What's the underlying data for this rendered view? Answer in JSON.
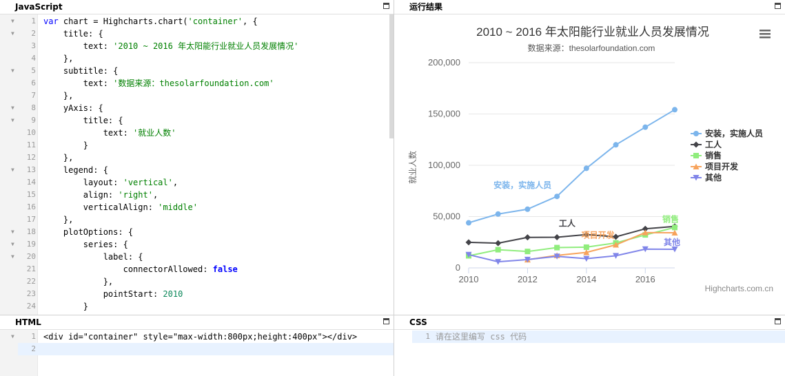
{
  "panels": {
    "js": {
      "title": "JavaScript"
    },
    "result": {
      "title": "运行结果"
    },
    "html": {
      "title": "HTML"
    },
    "css": {
      "title": "CSS"
    }
  },
  "js_lines": [
    {
      "n": "1",
      "fold": true,
      "tokens": [
        {
          "t": "var ",
          "c": "kw"
        },
        {
          "t": "chart = Highcharts.chart(",
          "c": ""
        },
        {
          "t": "'container'",
          "c": "str"
        },
        {
          "t": ", {",
          "c": ""
        }
      ]
    },
    {
      "n": "2",
      "fold": true,
      "tokens": [
        {
          "t": "    title: {",
          "c": ""
        }
      ]
    },
    {
      "n": "3",
      "fold": false,
      "tokens": [
        {
          "t": "        text: ",
          "c": ""
        },
        {
          "t": "'2010 ~ 2016 年太阳能行业就业人员发展情况'",
          "c": "str"
        }
      ]
    },
    {
      "n": "4",
      "fold": false,
      "tokens": [
        {
          "t": "    },",
          "c": ""
        }
      ]
    },
    {
      "n": "5",
      "fold": true,
      "tokens": [
        {
          "t": "    subtitle: {",
          "c": ""
        }
      ]
    },
    {
      "n": "6",
      "fold": false,
      "tokens": [
        {
          "t": "        text: ",
          "c": ""
        },
        {
          "t": "'数据来源：thesolarfoundation.com'",
          "c": "str"
        }
      ]
    },
    {
      "n": "7",
      "fold": false,
      "tokens": [
        {
          "t": "    },",
          "c": ""
        }
      ]
    },
    {
      "n": "8",
      "fold": true,
      "tokens": [
        {
          "t": "    yAxis: {",
          "c": ""
        }
      ]
    },
    {
      "n": "9",
      "fold": true,
      "tokens": [
        {
          "t": "        title: {",
          "c": ""
        }
      ]
    },
    {
      "n": "10",
      "fold": false,
      "tokens": [
        {
          "t": "            text: ",
          "c": ""
        },
        {
          "t": "'就业人数'",
          "c": "str"
        }
      ]
    },
    {
      "n": "11",
      "fold": false,
      "tokens": [
        {
          "t": "        }",
          "c": ""
        }
      ]
    },
    {
      "n": "12",
      "fold": false,
      "tokens": [
        {
          "t": "    },",
          "c": ""
        }
      ]
    },
    {
      "n": "13",
      "fold": true,
      "tokens": [
        {
          "t": "    legend: {",
          "c": ""
        }
      ]
    },
    {
      "n": "14",
      "fold": false,
      "tokens": [
        {
          "t": "        layout: ",
          "c": ""
        },
        {
          "t": "'vertical'",
          "c": "str"
        },
        {
          "t": ",",
          "c": ""
        }
      ]
    },
    {
      "n": "15",
      "fold": false,
      "tokens": [
        {
          "t": "        align: ",
          "c": ""
        },
        {
          "t": "'right'",
          "c": "str"
        },
        {
          "t": ",",
          "c": ""
        }
      ]
    },
    {
      "n": "16",
      "fold": false,
      "tokens": [
        {
          "t": "        verticalAlign: ",
          "c": ""
        },
        {
          "t": "'middle'",
          "c": "str"
        }
      ]
    },
    {
      "n": "17",
      "fold": false,
      "tokens": [
        {
          "t": "    },",
          "c": ""
        }
      ]
    },
    {
      "n": "18",
      "fold": true,
      "tokens": [
        {
          "t": "    plotOptions: {",
          "c": ""
        }
      ]
    },
    {
      "n": "19",
      "fold": true,
      "tokens": [
        {
          "t": "        series: {",
          "c": ""
        }
      ]
    },
    {
      "n": "20",
      "fold": true,
      "tokens": [
        {
          "t": "            label: {",
          "c": ""
        }
      ]
    },
    {
      "n": "21",
      "fold": false,
      "tokens": [
        {
          "t": "                connectorAllowed: ",
          "c": ""
        },
        {
          "t": "false",
          "c": "bool"
        }
      ]
    },
    {
      "n": "22",
      "fold": false,
      "tokens": [
        {
          "t": "            },",
          "c": ""
        }
      ]
    },
    {
      "n": "23",
      "fold": false,
      "tokens": [
        {
          "t": "            pointStart: ",
          "c": ""
        },
        {
          "t": "2010",
          "c": "num"
        }
      ]
    },
    {
      "n": "24",
      "fold": false,
      "tokens": [
        {
          "t": "        }",
          "c": ""
        }
      ]
    }
  ],
  "html_lines": [
    {
      "n": "1",
      "fold": true,
      "tokens": [
        {
          "t": "<div id=\"container\" style=\"max-width:800px;height:400px\"></div>",
          "c": ""
        }
      ]
    },
    {
      "n": "2",
      "fold": false,
      "tokens": []
    }
  ],
  "css_lines": [
    {
      "n": "1",
      "fold": false,
      "tokens": [
        {
          "t": "请在这里编写 css 代码",
          "c": "placeholder"
        }
      ]
    }
  ],
  "credits": "Highcharts.com.cn",
  "chart_data": {
    "type": "line",
    "title": "2010 ~ 2016 年太阳能行业就业人员发展情况",
    "subtitle": "数据来源：thesolarfoundation.com",
    "ylabel": "就业人数",
    "x": [
      2010,
      2011,
      2012,
      2013,
      2014,
      2015,
      2016,
      2017
    ],
    "xticks": [
      "2010",
      "2012",
      "2014",
      "2016"
    ],
    "yticks": [
      "0",
      "50,000",
      "100,000",
      "150,000",
      "200,000"
    ],
    "ylim": [
      0,
      200000
    ],
    "grid": true,
    "legend_position": "right-middle",
    "series": [
      {
        "name": "安装，实施人员",
        "color": "#7cb5ec",
        "marker": "circle",
        "values": [
          43934,
          52503,
          57177,
          69658,
          97031,
          119931,
          137133,
          154175
        ],
        "inline_label_at": 3
      },
      {
        "name": "工人",
        "color": "#434348",
        "marker": "diamond",
        "values": [
          24916,
          24064,
          29742,
          29851,
          32490,
          30282,
          38121,
          40434
        ],
        "inline_label_at": 4
      },
      {
        "name": "销售",
        "color": "#90ed7d",
        "marker": "square",
        "values": [
          11744,
          17722,
          16005,
          19771,
          20185,
          24377,
          32147,
          39387
        ],
        "inline_label_at": 7
      },
      {
        "name": "项目开发",
        "color": "#f7a35c",
        "marker": "triangle",
        "values": [
          null,
          null,
          7988,
          12169,
          15112,
          22452,
          34400,
          34227
        ],
        "inline_label_at": 5
      },
      {
        "name": "其他",
        "color": "#8085e9",
        "marker": "triangle-down",
        "values": [
          12908,
          5948,
          8105,
          11248,
          8989,
          11816,
          18274,
          18111
        ],
        "inline_label_at": 7
      }
    ]
  }
}
